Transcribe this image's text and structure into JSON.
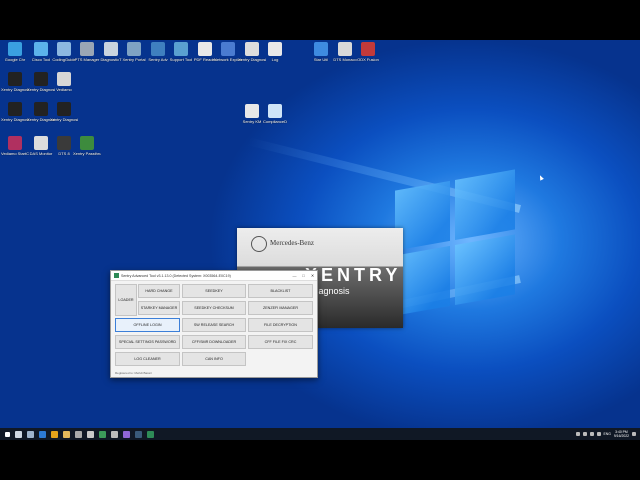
{
  "desktop": {
    "icons": [
      {
        "label": "Google Chr",
        "color": "#3aa0e0"
      },
      {
        "label": "Cisco Tool",
        "color": "#5cb3ea"
      },
      {
        "label": "CodingGuide",
        "color": "#8cb8e0"
      },
      {
        "label": "PTS Manager",
        "color": "#9aa6b5"
      },
      {
        "label": "DiagnosticT",
        "color": "#c9d4df"
      },
      {
        "label": "Xentry Portal",
        "color": "#7fa3c3"
      },
      {
        "label": "Sentry Adv",
        "color": "#3f7fbf"
      },
      {
        "label": "Support Tool",
        "color": "#5aa0d0"
      },
      {
        "label": "PDF Reader",
        "color": "#e8e8e8"
      },
      {
        "label": "Network Explorer",
        "color": "#4a7bd0"
      },
      {
        "label": "Xentry Diagnosis",
        "color": "#ddd"
      },
      {
        "label": "Log",
        "color": "#e8e8e8"
      },
      {
        "label": "Star Util",
        "color": "#3e8be0"
      },
      {
        "label": "DTS Monaco",
        "color": "#d9d9d9"
      },
      {
        "label": "ODX Fusion",
        "color": "#c23a3a"
      },
      {
        "label": "Xentry Diagnosis",
        "color": "#222"
      },
      {
        "label": "Xentry Diagnosis",
        "color": "#222"
      },
      {
        "label": "Vediamo",
        "color": "#d6d6d6"
      },
      {
        "label": "Xentry Diagnosis",
        "color": "#222"
      },
      {
        "label": "Xentry Diagnosis",
        "color": "#222"
      },
      {
        "label": "Xentry Diagnosis",
        "color": "#222"
      },
      {
        "label": "Vediamo StartCenter",
        "color": "#b03060"
      },
      {
        "label": "DAS Monitor",
        "color": "#dcdcdc"
      },
      {
        "label": "DTS 8",
        "color": "#3a3a3a"
      },
      {
        "label": "Xentry Passthru",
        "color": "#3d8b3d"
      },
      {
        "label": "Sentry KM",
        "color": "#e8e8e8"
      },
      {
        "label": "ComplianceD",
        "color": "#cfe4f7"
      }
    ]
  },
  "splash": {
    "maker": "Mercedes-Benz",
    "brand": "XENTRY",
    "subtitle": "Diagnosis"
  },
  "app_window": {
    "title": "Sentry Advanced Tool v3.1.13.0 (Detected System: X003564-E0C19)",
    "minimize": "—",
    "maximize": "□",
    "close": "✕",
    "buttons": {
      "loader": "LOADER",
      "hard_change": "HARD CHANGE",
      "seedkey": "SEEDKEY",
      "blacklist": "BLACKLIST",
      "starkey_manager": "STARKEY MANAGER",
      "seedkey_checksum": "SEEDKEY CHECKSUM",
      "zenzefi_manager": "ZENZEFI MANAGER",
      "offline_login": "OFFLINE LOGIN",
      "sw_release_search": "SW RELEASE SEARCH",
      "file_decryption": "FILE DECRYPTION",
      "special_settings_password": "SPECIAL SETTINGS PASSWORD",
      "cff_smr_downloader": "CFF/SMR DOWNLOADER",
      "cff_file_fix_crc": "CFF FILE FIX CRC",
      "log_cleaner": "LOG CLEANER",
      "can_info": "CAN INFO"
    },
    "footer": "Registered to: Mehdi Bassir"
  },
  "taskbar": {
    "language": "ENG",
    "time": "3:40 PM",
    "date": "9/16/2022"
  }
}
